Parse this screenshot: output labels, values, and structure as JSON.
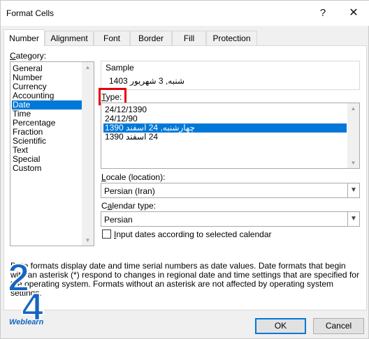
{
  "window": {
    "title": "Format Cells",
    "help_glyph": "?",
    "close_glyph": "✕"
  },
  "tabs": [
    {
      "label": "Number",
      "active": true
    },
    {
      "label": "Alignment"
    },
    {
      "label": "Font"
    },
    {
      "label": "Border"
    },
    {
      "label": "Fill"
    },
    {
      "label": "Protection"
    }
  ],
  "category": {
    "label_u": "C",
    "label_rest": "ategory:",
    "items": [
      "General",
      "Number",
      "Currency",
      "Accounting",
      "Date",
      "Time",
      "Percentage",
      "Fraction",
      "Scientific",
      "Text",
      "Special",
      "Custom"
    ],
    "selected": "Date"
  },
  "sample": {
    "label": "Sample",
    "value": "شنبه, 3 شهریور 1403"
  },
  "type": {
    "label_u": "T",
    "label_rest": "ype:",
    "items": [
      "24/12/1390",
      "24/12/90",
      "چهارشنبه, 24 اسفند 1390",
      "24 اسفند 1390"
    ],
    "selected_index": 2
  },
  "locale": {
    "label_u": "L",
    "label_rest": "ocale (location):",
    "value": "Persian (Iran)"
  },
  "calendar": {
    "label_pre": "C",
    "label_u": "a",
    "label_rest": "lendar type:",
    "value": "Persian"
  },
  "checkbox": {
    "label_u": "I",
    "label_rest": "nput dates according to selected calendar",
    "checked": false
  },
  "description": "Date formats display date and time serial numbers as date values.  Date formats that begin with an asterisk (*) respond to changes in regional date and time settings that are specified for the operating system. Formats without an asterisk are not affected by operating system settings.",
  "buttons": {
    "ok": "OK",
    "cancel": "Cancel"
  },
  "watermark": {
    "digits": "24",
    "text": "Weblearn"
  },
  "colors": {
    "accent": "#0078d7",
    "highlight": "#e8000b",
    "logo": "#1565c0"
  }
}
